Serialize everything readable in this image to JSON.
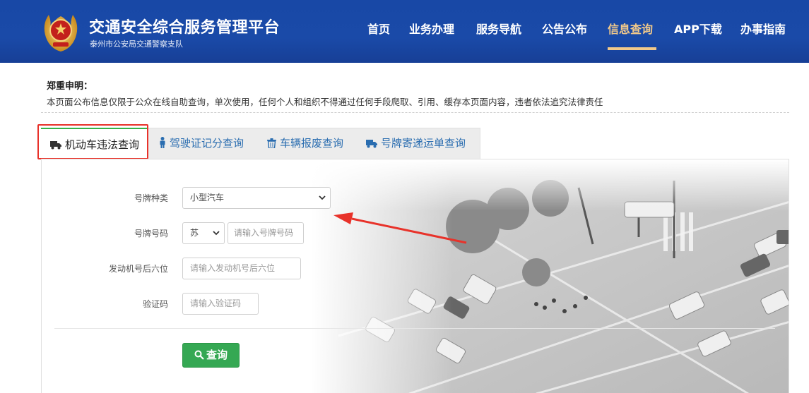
{
  "header": {
    "title": "交通安全综合服务管理平台",
    "subtitle": "泰州市公安局交通警察支队",
    "nav": [
      "首页",
      "业务办理",
      "服务导航",
      "公告公布",
      "信息查询",
      "APP下载",
      "办事指南"
    ],
    "active_nav": "信息查询",
    "colors": {
      "bar": "#1a4aa8",
      "active": "#f2c98a"
    }
  },
  "notice": {
    "title": "郑重申明：",
    "text": "本页面公布信息仅限于公众在线自助查询，单次使用，任何个人和组织不得通过任何手段爬取、引用、缓存本页面内容，违者依法追究法律责任"
  },
  "tabs": [
    {
      "label": "机动车违法查询",
      "icon": "truck-icon",
      "active": true
    },
    {
      "label": "驾驶证记分查询",
      "icon": "person-icon",
      "active": false
    },
    {
      "label": "车辆报废查询",
      "icon": "trash-icon",
      "active": false
    },
    {
      "label": "号牌寄递运单查询",
      "icon": "truck-icon",
      "active": false
    }
  ],
  "form": {
    "plate_type": {
      "label": "号牌种类",
      "value": "小型汽车"
    },
    "plate_number": {
      "label": "号牌号码",
      "province": "苏",
      "placeholder": "请输入号牌号码"
    },
    "engine": {
      "label": "发动机号后六位",
      "placeholder": "请输入发动机号后六位"
    },
    "captcha": {
      "label": "验证码",
      "placeholder": "请输入验证码"
    },
    "submit": "查询"
  },
  "annotation_colors": {
    "highlight": "#e8322a",
    "arrow": "#e8322a",
    "tab_accent": "#34b24a",
    "button": "#35a853"
  }
}
